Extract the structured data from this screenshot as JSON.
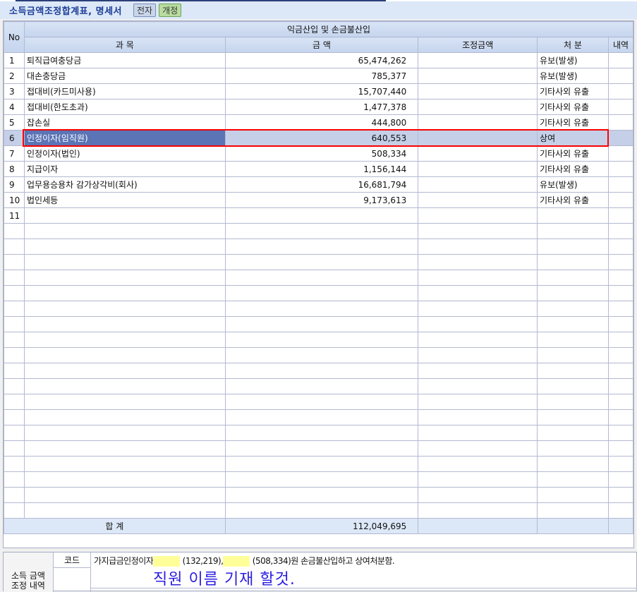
{
  "header": {
    "title": "소득금액조정합계표, 명세서",
    "btn_electronic": "전자",
    "btn_revision": "개정"
  },
  "table": {
    "group_header": "익금산입 및 손금불산입",
    "columns": {
      "no": "No",
      "subject": "과   목",
      "amount": "금   액",
      "adjust": "조정금액",
      "disposal": "처   분",
      "detail": "내역"
    },
    "rows": [
      {
        "no": "1",
        "subject": "퇴직급여충당금",
        "amount": "65,474,262",
        "disposal": "유보(발생)"
      },
      {
        "no": "2",
        "subject": "대손충당금",
        "amount": "785,377",
        "disposal": "유보(발생)"
      },
      {
        "no": "3",
        "subject": "접대비(카드미사용)",
        "amount": "15,707,440",
        "disposal": "기타사외 유출"
      },
      {
        "no": "4",
        "subject": "접대비(한도초과)",
        "amount": "1,477,378",
        "disposal": "기타사외 유출"
      },
      {
        "no": "5",
        "subject": "잡손실",
        "amount": "444,800",
        "disposal": "기타사외 유출"
      },
      {
        "no": "6",
        "subject": "인정이자(임직원)",
        "amount": "640,553",
        "disposal": "상여",
        "selected": true
      },
      {
        "no": "7",
        "subject": "인정이자(법인)",
        "amount": "508,334",
        "disposal": "기타사외 유출"
      },
      {
        "no": "8",
        "subject": "지급이자",
        "amount": "1,156,144",
        "disposal": "기타사외 유출"
      },
      {
        "no": "9",
        "subject": "업무용승용차 감가상각비(회사)",
        "amount": "16,681,794",
        "disposal": "유보(발생)"
      },
      {
        "no": "10",
        "subject": "법인세등",
        "amount": "9,173,613",
        "disposal": "기타사외 유출"
      },
      {
        "no": "11",
        "subject": "",
        "amount": "",
        "disposal": ""
      }
    ],
    "total": {
      "label": "합 계",
      "amount": "112,049,695"
    }
  },
  "bottom": {
    "section_label_1": "소득 금액",
    "section_label_2": "조정 내역",
    "code_label": "코드",
    "text_1": "가지급금인정이자",
    "text_2": "(132,219),",
    "text_3": "(508,334)원 손금불산입하고 상여처분함.",
    "note": "직원 이름 기재 할것."
  },
  "colors": {
    "selection": "#5b74b5",
    "highlight_box": "#ff0000",
    "note_text": "#2b1de0",
    "marker": "#ffff99"
  }
}
